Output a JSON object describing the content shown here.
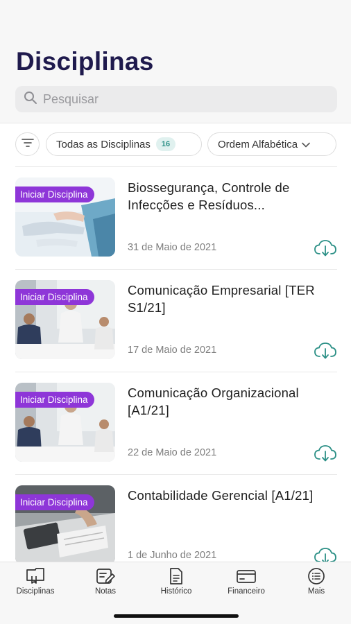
{
  "header": {
    "title": "Disciplinas",
    "search_placeholder": "Pesquisar"
  },
  "filters": {
    "all_label": "Todas as Disciplinas",
    "count": "16",
    "sort_label": "Ordem Alfabética"
  },
  "courses": [
    {
      "badge": "Iniciar Disciplina",
      "title": "Biossegurança, Controle de Infecções e Resíduos...",
      "date": "31 de Maio de 2021"
    },
    {
      "badge": "Iniciar Disciplina",
      "title": "Comunicação Empresarial [TER S1/21]",
      "date": "17 de Maio de 2021"
    },
    {
      "badge": "Iniciar Disciplina",
      "title": "Comunicação Organizacional [A1/21]",
      "date": "22 de Maio de 2021"
    },
    {
      "badge": "Iniciar Disciplina",
      "title": "Contabilidade Gerencial [A1/21]",
      "date": "1 de Junho de 2021"
    }
  ],
  "tabbar": {
    "disciplinas": "Disciplinas",
    "notas": "Notas",
    "historico": "Histórico",
    "financeiro": "Financeiro",
    "mais": "Mais"
  },
  "colors": {
    "title": "#1f1a4d",
    "badge": "#8e36d8",
    "accent": "#2a8f85"
  }
}
